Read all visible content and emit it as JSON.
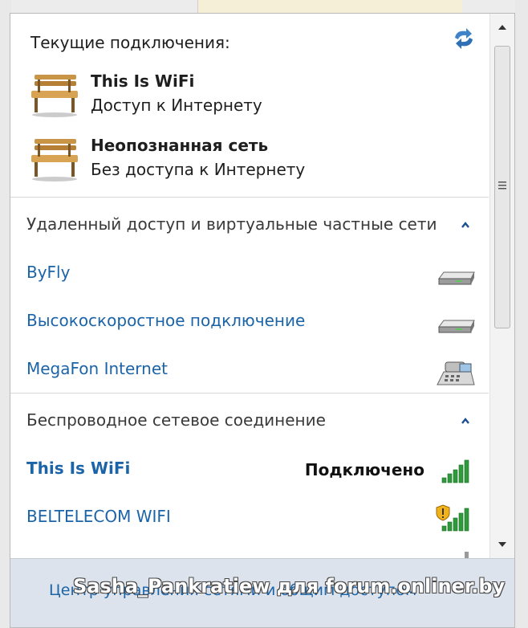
{
  "current": {
    "title": "Текущие подключения:",
    "connections": [
      {
        "name": "This Is WiFi",
        "status": "Доступ к Интернету"
      },
      {
        "name": "Неопознанная сеть",
        "status": "Без доступа к Интернету"
      }
    ]
  },
  "sections": [
    {
      "label": "Удаленный доступ и виртуальные частные сети",
      "items": [
        {
          "label": "ByFly",
          "icon": "modem-icon"
        },
        {
          "label": "Высокоскоростное подключение",
          "icon": "modem-icon"
        },
        {
          "label": "MegaFon Internet",
          "icon": "dialup-phone-icon"
        }
      ]
    },
    {
      "label": "Беспроводное сетевое соединение",
      "items": [
        {
          "label": "This Is WiFi",
          "status": "Подключено",
          "icon": "wifi-signal-icon"
        },
        {
          "label": "BELTELECOM WIFI",
          "icon": "wifi-signal-secured-warning-icon"
        }
      ]
    }
  ],
  "footer": {
    "link": "Центр управления сетями и общим доступом",
    "watermark": "Sasha_Pankratiew для forum.onliner.by"
  },
  "colors": {
    "link": "#1c64a8",
    "signal_green": "#2e9a3a",
    "footer_bg": "#dde3ec"
  }
}
